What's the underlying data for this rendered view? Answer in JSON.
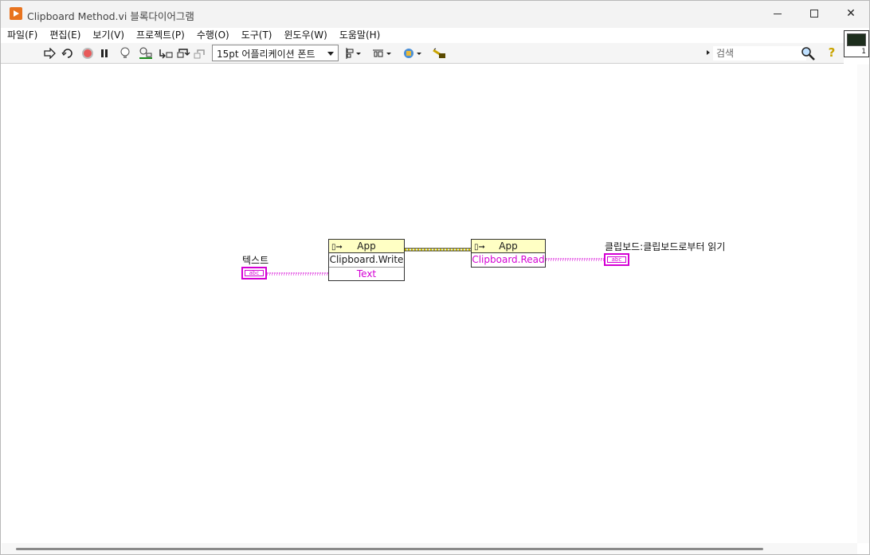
{
  "window": {
    "title": "Clipboard Method.vi 블록다이어그램"
  },
  "menu": [
    "파일(F)",
    "편집(E)",
    "보기(V)",
    "프로젝트(P)",
    "수행(O)",
    "도구(T)",
    "윈도우(W)",
    "도움말(H)"
  ],
  "toolbar": {
    "font": "15pt 어플리케이션 폰트",
    "search_placeholder": "검색",
    "help": "?"
  },
  "connector_pane": {
    "number": "1"
  },
  "diagram": {
    "control_label": "텍스트",
    "indicator_label": "클립보드:클립보드로부터 읽기",
    "terminal_glyph": "abc",
    "write_node": {
      "class": "App",
      "method": "Clipboard.Write",
      "param": "Text"
    },
    "read_node": {
      "class": "App",
      "method": "Clipboard.Read"
    }
  },
  "colors": {
    "string_wire": "#d400d4",
    "refnum_wire": "#8a7a00",
    "node_header": "#ffffc4"
  }
}
